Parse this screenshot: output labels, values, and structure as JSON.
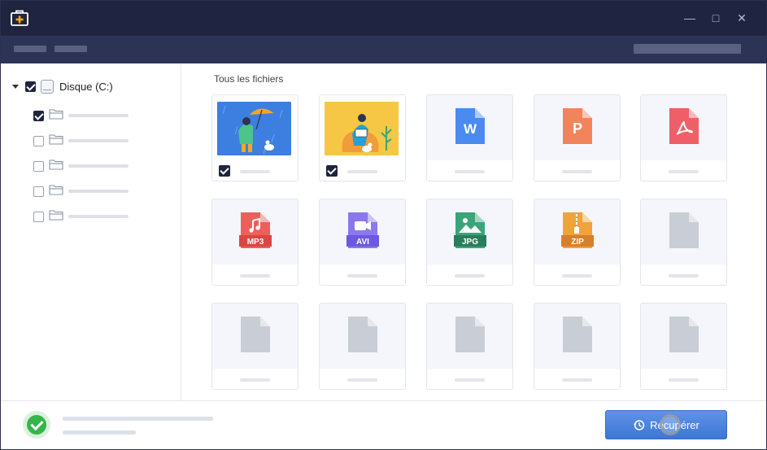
{
  "titlebar": {
    "app_icon": "first-aid-box-icon",
    "minimize_icon": "minimize-icon",
    "maximize_icon": "maximize-icon",
    "close_icon": "close-icon",
    "minimize_glyph": "—",
    "maximize_glyph": "□",
    "close_glyph": "✕"
  },
  "sidebar": {
    "root": {
      "label": "Disque (C:)",
      "checked": true,
      "icon": "drive-icon"
    },
    "children": [
      {
        "checked": true,
        "icon": "folder-icon"
      },
      {
        "checked": false,
        "icon": "folder-icon"
      },
      {
        "checked": false,
        "icon": "folder-icon"
      },
      {
        "checked": false,
        "icon": "folder-icon"
      },
      {
        "checked": false,
        "icon": "folder-icon"
      }
    ]
  },
  "main": {
    "section_title": "Tous les fichiers",
    "files": [
      {
        "type": "image",
        "icon": "umbrella-illustration",
        "checked": true
      },
      {
        "type": "image",
        "icon": "reading-illustration",
        "checked": true
      },
      {
        "type": "word",
        "icon": "word-document-icon",
        "label": "W"
      },
      {
        "type": "powerpoint",
        "icon": "powerpoint-icon",
        "label": "P"
      },
      {
        "type": "pdf",
        "icon": "pdf-icon"
      },
      {
        "type": "mp3",
        "icon": "mp3-file-icon",
        "label": "MP3"
      },
      {
        "type": "avi",
        "icon": "avi-file-icon",
        "label": "AVI"
      },
      {
        "type": "jpg",
        "icon": "jpg-file-icon",
        "label": "JPG"
      },
      {
        "type": "zip",
        "icon": "zip-file-icon",
        "label": "ZIP"
      },
      {
        "type": "generic",
        "icon": "file-icon"
      },
      {
        "type": "generic",
        "icon": "file-icon"
      },
      {
        "type": "generic",
        "icon": "file-icon"
      },
      {
        "type": "generic",
        "icon": "file-icon"
      },
      {
        "type": "generic",
        "icon": "file-icon"
      },
      {
        "type": "generic",
        "icon": "file-icon"
      }
    ]
  },
  "bottom": {
    "status_icon": "success-check-icon",
    "recover_button": {
      "label": "Récupérer",
      "icon": "history-icon"
    }
  },
  "colors": {
    "titlebar": "#1f2540",
    "toolbar": "#2d3354",
    "accent": "#3c76d8",
    "success": "#36b54a",
    "word": "#4a8bf0",
    "powerpoint": "#f2845c",
    "pdf": "#ee5f68",
    "mp3": "#ee5f5b",
    "avi": "#8b78ee",
    "jpg": "#3aa57a",
    "zip": "#f0a23b",
    "generic": "#c9cdd5"
  }
}
